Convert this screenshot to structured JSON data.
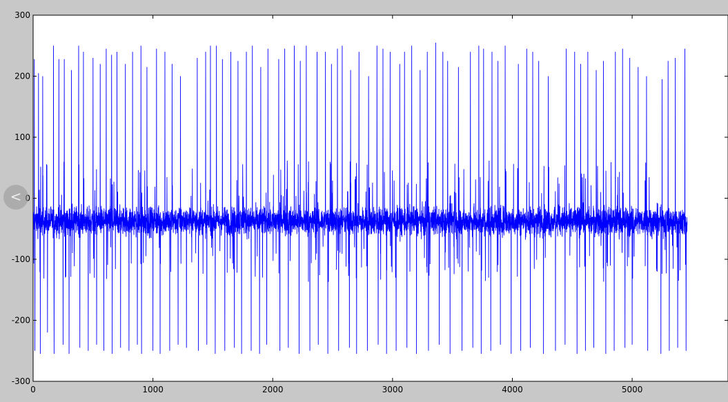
{
  "nav": {
    "back_icon": "chevron-left-icon",
    "back_glyph": "<"
  },
  "chart_data": {
    "type": "line",
    "title": "",
    "xlabel": "",
    "ylabel": "",
    "xlim": [
      0,
      5800
    ],
    "ylim": [
      -300,
      300
    ],
    "xticks": [
      0,
      1000,
      2000,
      3000,
      4000,
      5000
    ],
    "xtick_labels": [
      "0",
      "1000",
      "2000",
      "3000",
      "4000",
      "5000"
    ],
    "yticks": [
      300,
      200,
      100,
      0,
      -100,
      -200,
      -300
    ],
    "ytick_labels": [
      "300",
      "200",
      "100",
      "0",
      "-100",
      "-200",
      "-300"
    ],
    "grid": false,
    "legend": "none",
    "colors": {
      "series": "#0000ff",
      "axes_bg": "#ffffff",
      "figure_bg": "#c8c8c8"
    },
    "series": [
      {
        "n_points": 5460,
        "baseline": -38,
        "noise_band": [
          -70,
          -5
        ],
        "spikes_up": [
          {
            "x": 10,
            "y": 228
          },
          {
            "x": 45,
            "y": 205
          },
          {
            "x": 80,
            "y": 200
          },
          {
            "x": 170,
            "y": 250
          },
          {
            "x": 215,
            "y": 228
          },
          {
            "x": 260,
            "y": 228
          },
          {
            "x": 320,
            "y": 210
          },
          {
            "x": 380,
            "y": 250
          },
          {
            "x": 420,
            "y": 240
          },
          {
            "x": 500,
            "y": 230
          },
          {
            "x": 560,
            "y": 220
          },
          {
            "x": 610,
            "y": 245
          },
          {
            "x": 655,
            "y": 235
          },
          {
            "x": 700,
            "y": 240
          },
          {
            "x": 770,
            "y": 220
          },
          {
            "x": 830,
            "y": 240
          },
          {
            "x": 900,
            "y": 250
          },
          {
            "x": 950,
            "y": 215
          },
          {
            "x": 1030,
            "y": 245
          },
          {
            "x": 1100,
            "y": 240
          },
          {
            "x": 1160,
            "y": 220
          },
          {
            "x": 1230,
            "y": 200
          },
          {
            "x": 1370,
            "y": 230
          },
          {
            "x": 1440,
            "y": 240
          },
          {
            "x": 1480,
            "y": 250
          },
          {
            "x": 1530,
            "y": 250
          },
          {
            "x": 1580,
            "y": 228
          },
          {
            "x": 1650,
            "y": 240
          },
          {
            "x": 1710,
            "y": 225
          },
          {
            "x": 1780,
            "y": 240
          },
          {
            "x": 1830,
            "y": 250
          },
          {
            "x": 1900,
            "y": 215
          },
          {
            "x": 1960,
            "y": 245
          },
          {
            "x": 2050,
            "y": 228
          },
          {
            "x": 2100,
            "y": 245
          },
          {
            "x": 2180,
            "y": 250
          },
          {
            "x": 2230,
            "y": 225
          },
          {
            "x": 2280,
            "y": 250
          },
          {
            "x": 2370,
            "y": 240
          },
          {
            "x": 2440,
            "y": 240
          },
          {
            "x": 2490,
            "y": 220
          },
          {
            "x": 2540,
            "y": 245
          },
          {
            "x": 2580,
            "y": 250
          },
          {
            "x": 2650,
            "y": 210
          },
          {
            "x": 2720,
            "y": 240
          },
          {
            "x": 2800,
            "y": 200
          },
          {
            "x": 2870,
            "y": 250
          },
          {
            "x": 2920,
            "y": 245
          },
          {
            "x": 2980,
            "y": 240
          },
          {
            "x": 3060,
            "y": 220
          },
          {
            "x": 3100,
            "y": 240
          },
          {
            "x": 3160,
            "y": 250
          },
          {
            "x": 3230,
            "y": 210
          },
          {
            "x": 3290,
            "y": 240
          },
          {
            "x": 3360,
            "y": 255
          },
          {
            "x": 3420,
            "y": 240
          },
          {
            "x": 3460,
            "y": 225
          },
          {
            "x": 3550,
            "y": 215
          },
          {
            "x": 3650,
            "y": 240
          },
          {
            "x": 3720,
            "y": 250
          },
          {
            "x": 3760,
            "y": 245
          },
          {
            "x": 3830,
            "y": 240
          },
          {
            "x": 3880,
            "y": 225
          },
          {
            "x": 3940,
            "y": 250
          },
          {
            "x": 4050,
            "y": 220
          },
          {
            "x": 4120,
            "y": 245
          },
          {
            "x": 4170,
            "y": 240
          },
          {
            "x": 4220,
            "y": 225
          },
          {
            "x": 4300,
            "y": 200
          },
          {
            "x": 4450,
            "y": 245
          },
          {
            "x": 4520,
            "y": 240
          },
          {
            "x": 4570,
            "y": 220
          },
          {
            "x": 4630,
            "y": 240
          },
          {
            "x": 4700,
            "y": 210
          },
          {
            "x": 4760,
            "y": 225
          },
          {
            "x": 4860,
            "y": 240
          },
          {
            "x": 4920,
            "y": 245
          },
          {
            "x": 4980,
            "y": 230
          },
          {
            "x": 5050,
            "y": 215
          },
          {
            "x": 5120,
            "y": 200
          },
          {
            "x": 5250,
            "y": 195
          },
          {
            "x": 5300,
            "y": 225
          },
          {
            "x": 5360,
            "y": 230
          },
          {
            "x": 5440,
            "y": 245
          }
        ],
        "spikes_down": [
          {
            "x": 15,
            "y": -250
          },
          {
            "x": 60,
            "y": -255
          },
          {
            "x": 120,
            "y": -220
          },
          {
            "x": 175,
            "y": -255
          },
          {
            "x": 250,
            "y": -240
          },
          {
            "x": 300,
            "y": -255
          },
          {
            "x": 390,
            "y": -245
          },
          {
            "x": 460,
            "y": -250
          },
          {
            "x": 530,
            "y": -240
          },
          {
            "x": 590,
            "y": -250
          },
          {
            "x": 660,
            "y": -255
          },
          {
            "x": 730,
            "y": -245
          },
          {
            "x": 800,
            "y": -250
          },
          {
            "x": 870,
            "y": -240
          },
          {
            "x": 905,
            "y": -255
          },
          {
            "x": 1000,
            "y": -250
          },
          {
            "x": 1060,
            "y": -255
          },
          {
            "x": 1140,
            "y": -250
          },
          {
            "x": 1210,
            "y": -240
          },
          {
            "x": 1280,
            "y": -245
          },
          {
            "x": 1380,
            "y": -250
          },
          {
            "x": 1450,
            "y": -240
          },
          {
            "x": 1520,
            "y": -255
          },
          {
            "x": 1600,
            "y": -250
          },
          {
            "x": 1680,
            "y": -245
          },
          {
            "x": 1740,
            "y": -255
          },
          {
            "x": 1820,
            "y": -250
          },
          {
            "x": 1890,
            "y": -255
          },
          {
            "x": 1950,
            "y": -240
          },
          {
            "x": 2060,
            "y": -250
          },
          {
            "x": 2130,
            "y": -245
          },
          {
            "x": 2220,
            "y": -255
          },
          {
            "x": 2310,
            "y": -250
          },
          {
            "x": 2380,
            "y": -240
          },
          {
            "x": 2460,
            "y": -255
          },
          {
            "x": 2550,
            "y": -250
          },
          {
            "x": 2640,
            "y": -245
          },
          {
            "x": 2700,
            "y": -255
          },
          {
            "x": 2790,
            "y": -250
          },
          {
            "x": 2880,
            "y": -240
          },
          {
            "x": 2950,
            "y": -255
          },
          {
            "x": 3030,
            "y": -250
          },
          {
            "x": 3120,
            "y": -245
          },
          {
            "x": 3200,
            "y": -255
          },
          {
            "x": 3300,
            "y": -250
          },
          {
            "x": 3390,
            "y": -240
          },
          {
            "x": 3480,
            "y": -255
          },
          {
            "x": 3580,
            "y": -250
          },
          {
            "x": 3670,
            "y": -245
          },
          {
            "x": 3740,
            "y": -255
          },
          {
            "x": 3820,
            "y": -250
          },
          {
            "x": 3900,
            "y": -240
          },
          {
            "x": 3990,
            "y": -255
          },
          {
            "x": 4070,
            "y": -250
          },
          {
            "x": 4150,
            "y": -245
          },
          {
            "x": 4260,
            "y": -255
          },
          {
            "x": 4360,
            "y": -250
          },
          {
            "x": 4440,
            "y": -240
          },
          {
            "x": 4540,
            "y": -255
          },
          {
            "x": 4610,
            "y": -250
          },
          {
            "x": 4680,
            "y": -245
          },
          {
            "x": 4780,
            "y": -255
          },
          {
            "x": 4850,
            "y": -250
          },
          {
            "x": 4940,
            "y": -245
          },
          {
            "x": 5000,
            "y": -240
          },
          {
            "x": 5130,
            "y": -250
          },
          {
            "x": 5240,
            "y": -255
          },
          {
            "x": 5310,
            "y": -250
          },
          {
            "x": 5380,
            "y": -245
          },
          {
            "x": 5450,
            "y": -250
          }
        ]
      }
    ]
  }
}
